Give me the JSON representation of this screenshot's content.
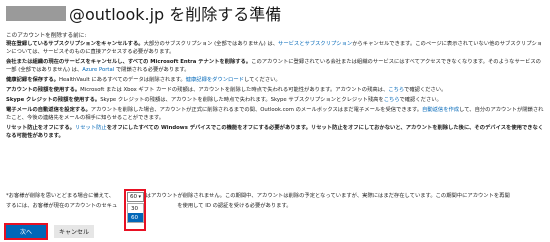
{
  "header": {
    "title_text": "@outlook.jp を削除する準備"
  },
  "intro": "このアカウントを削除する前に:",
  "items": [
    {
      "bold": "現在登録しているサブスクリプションをキャンセルする。",
      "text": "大部分のサブスクリプション (全部ではありません) は、",
      "link": "サービスとサブスクリプション",
      "text2": "からキャンセルできます。このページに表示されていない他のサブスクリプションについては、サービスそのものに直接アクセスする必要があります。"
    },
    {
      "bold": "会社または組織の現在のサービスをキャンセルし、すべての Microsoft Entra テナントを削除する。",
      "text": "このアカウントに登録されている会社または組織のサービスにはすべてアクセスできなくなります。そのようなサービスの一部 (全部ではありません) は、",
      "link": "Azure Portal",
      "text2": " で閉鎖される必要があります。"
    },
    {
      "bold": "健康記録を保存する。",
      "text": "HealthVault にあるすべてのデータは削除されます。",
      "link": "健康記録をダウンロード",
      "text2": "してください。"
    },
    {
      "bold": "アカウントの残額を使用する。",
      "text": "Microsoft または Xbox ギフト カードの残額は、アカウントを削除した時点で失われる可能性があります。アカウントの残高は、",
      "link": "こちら",
      "text2": "で確認ください。"
    },
    {
      "bold": "Skype クレジットの残額を使用する。",
      "text": "Skype クレジットの残額は、アカウントを削除した時点で失われます。Skype サブスクリプションとクレジット残高を",
      "link": "こちら",
      "text2": "で確認ください。"
    },
    {
      "bold": "電子メールの自動返信を設定する。",
      "text": "アカウントを削除した場合、アカウントが正式に削除されるまでの間、Outlook.com のメールボックスはまだ電子メールを受信できます。",
      "link": "自動返信を作成",
      "text2": "して、自分のアカウントが閉鎖されたこと、今後の連絡先をメールの相手に知らせることができます。"
    },
    {
      "bold": "リセット防止をオフにする。",
      "text": "",
      "link": "リセット防止",
      "text2": "をオフにしたすべての Windows デバイスでこの機能をオフにする必要があります。リセット防止をオフにしておかないと、アカウントを削除した後に、そのデバイスを使用できなくなる可能性があります。"
    }
  ],
  "bottom": {
    "line1_a": "*お客様が削除を思いとどまる場合に備えて、",
    "line1_b": "日間はアカウントが削除されません。この期間中、アカウントは削除の予定となっていますが、実際にはまだ存在しています。この期間中にアカウントを再開",
    "line2_a": "するには、お客様が現在のアカウントのセキュ",
    "line2_b": "を使用して ID の認証を受ける必要があります。"
  },
  "dropdown": {
    "selected": "60",
    "options": [
      "30",
      "60"
    ]
  },
  "buttons": {
    "next": "次へ",
    "cancel": "キャンセル"
  },
  "colors": {
    "accent": "#0067b8",
    "highlight": "#e81123"
  }
}
